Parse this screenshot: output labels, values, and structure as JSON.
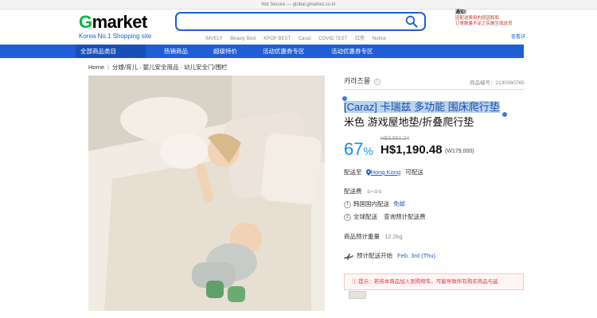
{
  "browser": {
    "url_text": "Not Secure — global.gmarket.co.kr"
  },
  "header": {
    "logo_g": "G",
    "logo_rest": "market",
    "logo_tagline": "Korea No.1 Shopping site",
    "search": {
      "value": "",
      "placeholder": ""
    },
    "quick_links": [
      "IMVELY",
      "Beauty Best",
      "KPOP BEST",
      "Caraz",
      "COVID TEST",
      "红参",
      "Notice"
    ],
    "notice": {
      "title": "通知!",
      "text": "因配送费用的原因和和\n订单数量不足之实施生成送货\n",
      "link": "查看详"
    }
  },
  "nav": {
    "category": "全部商品类目",
    "items": [
      "热销商品",
      "超级特价",
      "活动优惠券专区",
      "活动优惠券专区"
    ]
  },
  "breadcrumb": [
    "Home",
    "分娩/育儿",
    "婴儿安全用品",
    "幼儿安全门/围栏"
  ],
  "product": {
    "brand": "카라즈몰",
    "brand_icon": "i",
    "product_no": "商品编号：2130360765",
    "title_selected": "[Caraz] 卡瑞兹 多功能 围床爬行垫",
    "title_rest": "米色 游戏屋地垫/折叠爬行垫",
    "discount_value": "67",
    "discount_unit": "%",
    "original_price": "H$3,651.24",
    "sale_price": "H$1,190.48",
    "krw_price": "(W179,000)",
    "ship_to_label": "配送至",
    "ship_to_location": "Hong Kong",
    "ship_to_status": "可配送",
    "shipping_fee_label": "配送费",
    "shipping_fee_note": "①+②①",
    "domestic_num": "1",
    "domestic_label": "韩国国内配送",
    "domestic_value": "免邮",
    "global_num": "2",
    "global_label": "全球配送",
    "global_value": "查询预计配送费",
    "weight_label": "商品预计重量",
    "weight_value": "12.2kg",
    "delivery_label": "预计配送开始",
    "delivery_value": "Feb. 3rd (Thu)",
    "warning": "ⓘ 提示：若将本商品加入到购物车，可能导致所有购买商品与延",
    "colors": {
      "accent": "#1f5ed4",
      "discount": "#1a8fe6",
      "brand_green": "#00b83f",
      "warning": "#d23b3b"
    }
  }
}
